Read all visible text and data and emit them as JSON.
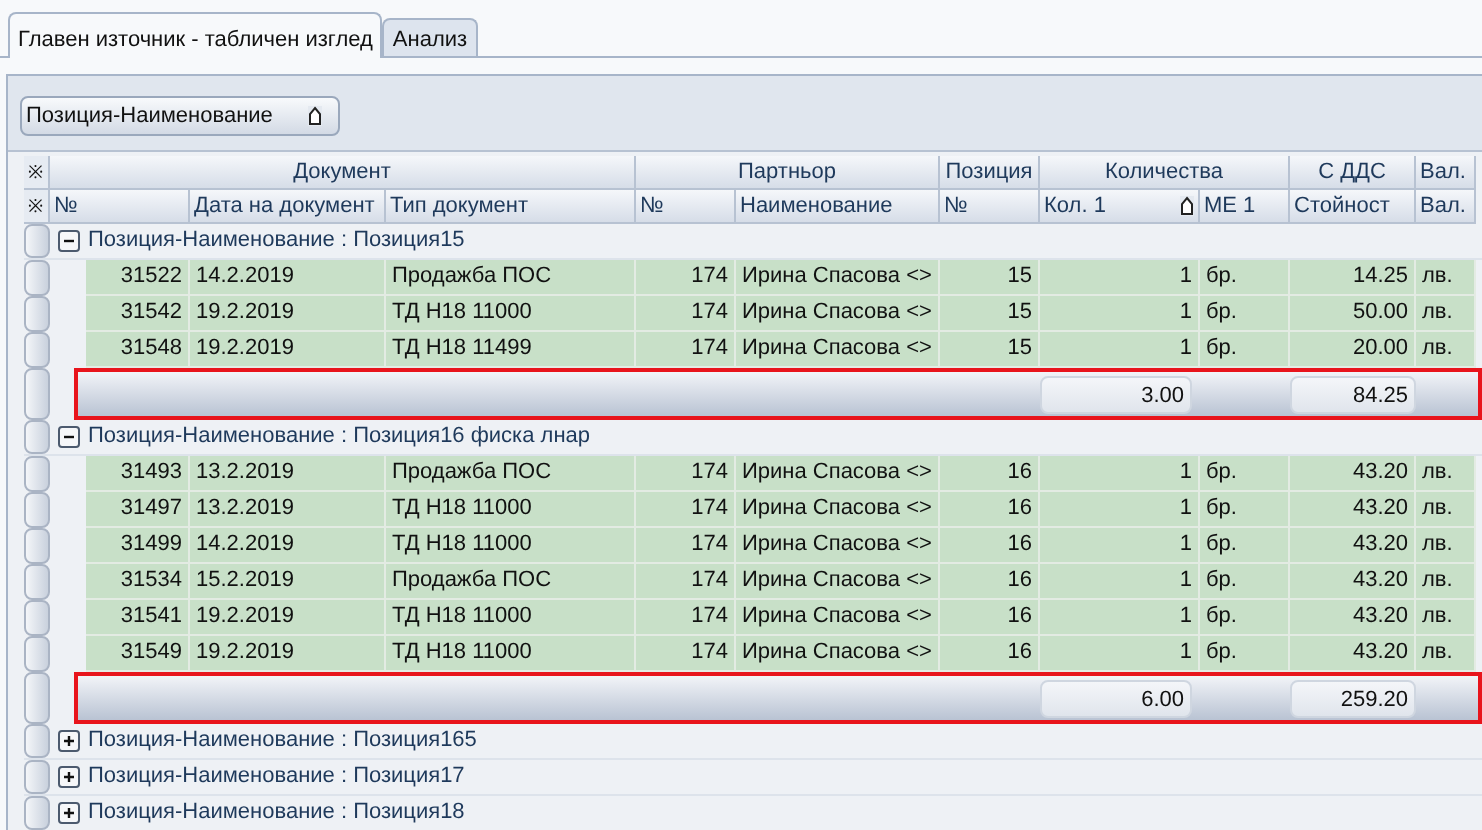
{
  "tabs": [
    {
      "label": "Главен източник - табличен изглед",
      "selected": true
    },
    {
      "label": "Анализ",
      "selected": false
    }
  ],
  "group_by_button": {
    "label": "Позиция-Наименование",
    "sorted": true
  },
  "header_markers": [
    "※",
    "※"
  ],
  "header_bands": [
    {
      "label": "Документ"
    },
    {
      "label": "Партньор"
    },
    {
      "label": "Позиция"
    },
    {
      "label": "Количества"
    },
    {
      "label": "С ДДС"
    },
    {
      "label": "Вал."
    }
  ],
  "columns": [
    {
      "label": "№",
      "sorted": false
    },
    {
      "label": "Дата на документ",
      "sorted": false
    },
    {
      "label": "Тип документ",
      "sorted": false
    },
    {
      "label": "№",
      "sorted": false
    },
    {
      "label": "Наименование",
      "sorted": false
    },
    {
      "label": "№",
      "sorted": false
    },
    {
      "label": "Кол. 1",
      "sorted": true
    },
    {
      "label": "МЕ 1",
      "sorted": false
    },
    {
      "label": "Стойност",
      "sorted": false
    },
    {
      "label": "Вал.",
      "sorted": false
    }
  ],
  "groups": [
    {
      "caption": "Позиция-Наименование : Позиция15",
      "expanded": true,
      "rows": [
        [
          "31522",
          "14.2.2019",
          "Продажба ПОС",
          "174",
          "Ирина Спасова <>",
          "15",
          "1",
          "бр.",
          "14.25",
          "лв."
        ],
        [
          "31542",
          "19.2.2019",
          "ТД Н18 11000",
          "174",
          "Ирина Спасова <>",
          "15",
          "1",
          "бр.",
          "50.00",
          "лв."
        ],
        [
          "31548",
          "19.2.2019",
          "ТД Н18 11499",
          "174",
          "Ирина Спасова <>",
          "15",
          "1",
          "бр.",
          "20.00",
          "лв."
        ]
      ],
      "totals": {
        "quantity": "3.00",
        "value": "84.25",
        "highlighted": true
      }
    },
    {
      "caption": "Позиция-Наименование : Позиция16 фиска лнар",
      "expanded": true,
      "rows": [
        [
          "31493",
          "13.2.2019",
          "Продажба ПОС",
          "174",
          "Ирина Спасова <>",
          "16",
          "1",
          "бр.",
          "43.20",
          "лв."
        ],
        [
          "31497",
          "13.2.2019",
          "ТД Н18 11000",
          "174",
          "Ирина Спасова <>",
          "16",
          "1",
          "бр.",
          "43.20",
          "лв."
        ],
        [
          "31499",
          "14.2.2019",
          "ТД Н18 11000",
          "174",
          "Ирина Спасова <>",
          "16",
          "1",
          "бр.",
          "43.20",
          "лв."
        ],
        [
          "31534",
          "15.2.2019",
          "Продажба ПОС",
          "174",
          "Ирина Спасова <>",
          "16",
          "1",
          "бр.",
          "43.20",
          "лв."
        ],
        [
          "31541",
          "19.2.2019",
          "ТД Н18 11000",
          "174",
          "Ирина Спасова <>",
          "16",
          "1",
          "бр.",
          "43.20",
          "лв."
        ],
        [
          "31549",
          "19.2.2019",
          "ТД Н18 11000",
          "174",
          "Ирина Спасова <>",
          "16",
          "1",
          "бр.",
          "43.20",
          "лв."
        ]
      ],
      "totals": {
        "quantity": "6.00",
        "value": "259.20",
        "highlighted": true
      }
    },
    {
      "caption": "Позиция-Наименование : Позиция165",
      "expanded": false
    },
    {
      "caption": "Позиция-Наименование : Позиция17",
      "expanded": false
    },
    {
      "caption": "Позиция-Наименование : Позиция18",
      "expanded": false
    }
  ]
}
